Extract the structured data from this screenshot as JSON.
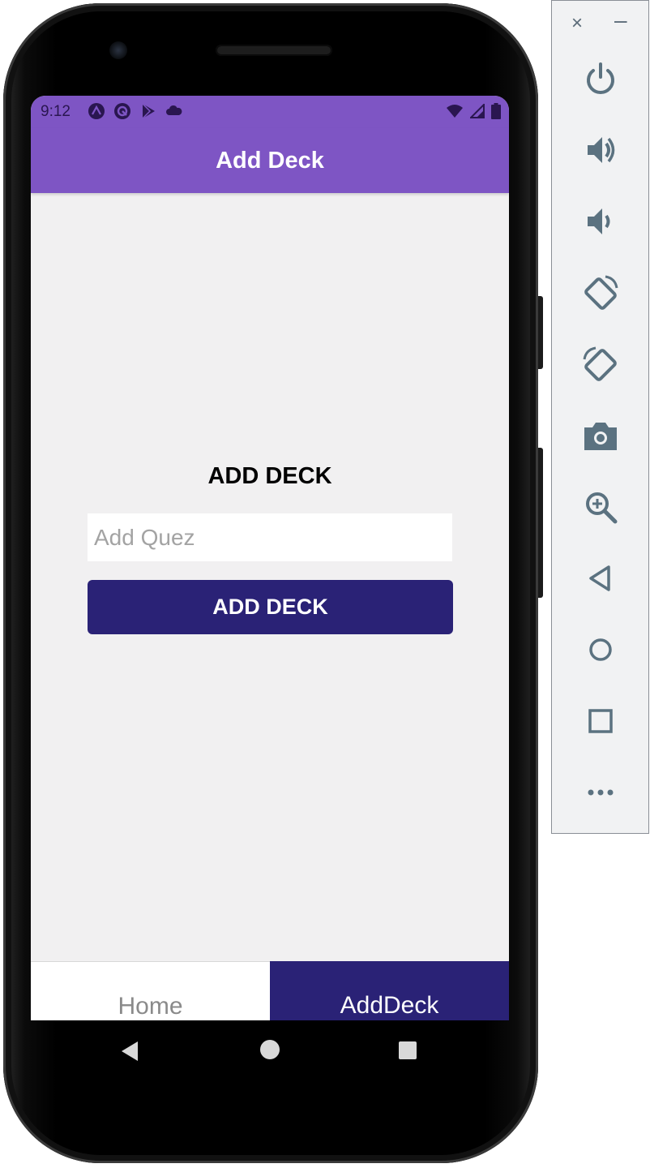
{
  "status_bar": {
    "time": "9:12"
  },
  "app_bar": {
    "title": "Add Deck"
  },
  "main": {
    "heading": "ADD DECK",
    "input_value": "",
    "input_placeholder": "Add Quez",
    "submit_label": "ADD DECK"
  },
  "tabs": [
    {
      "label": "Home",
      "active": false
    },
    {
      "label": "AddDeck",
      "active": true
    }
  ],
  "emulator_panel": {
    "close_glyph": "×",
    "minimize_glyph": "–",
    "controls": [
      "power-icon",
      "volume-up-icon",
      "volume-down-icon",
      "rotate-left-icon",
      "rotate-right-icon",
      "camera-icon",
      "zoom-icon",
      "back-icon",
      "home-icon",
      "overview-icon",
      "more-icon"
    ]
  },
  "colors": {
    "app_bar": "#7e55c4",
    "primary_button": "#2a2276",
    "active_tab": "#2a2276",
    "screen_background": "#f1f0f1",
    "panel_icon": "#5b7280"
  }
}
